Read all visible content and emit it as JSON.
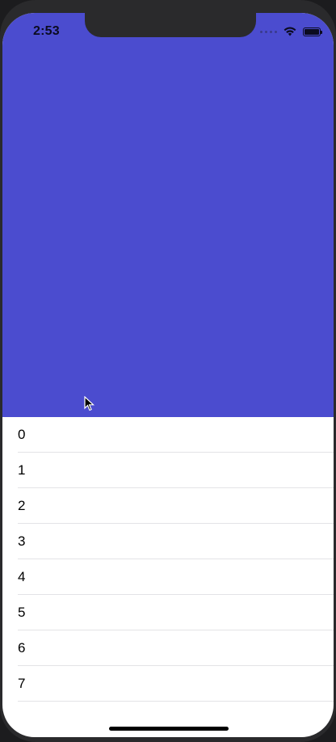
{
  "status_bar": {
    "time": "2:53",
    "icons": [
      "signal-dots-icon",
      "wifi-icon",
      "battery-icon"
    ]
  },
  "header": {
    "color": "#4b4ccf"
  },
  "list": {
    "rows": [
      {
        "label": "0"
      },
      {
        "label": "1"
      },
      {
        "label": "2"
      },
      {
        "label": "3"
      },
      {
        "label": "4"
      },
      {
        "label": "5"
      },
      {
        "label": "6"
      },
      {
        "label": "7"
      }
    ]
  }
}
